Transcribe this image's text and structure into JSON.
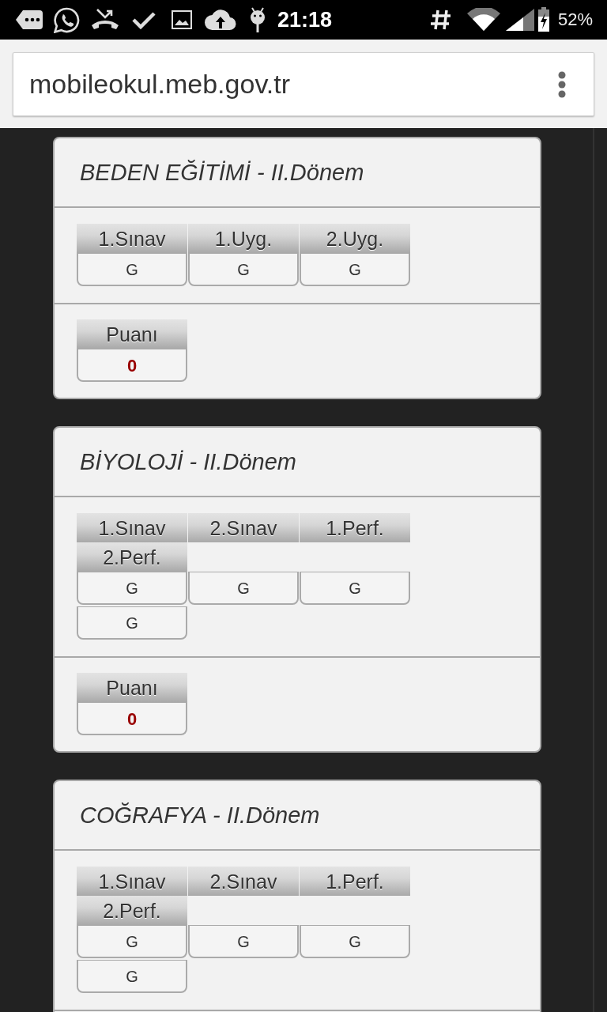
{
  "status_bar": {
    "time": "21:18",
    "battery_percent": "52%"
  },
  "browser": {
    "url": "mobileokul.meb.gov.tr"
  },
  "courses": [
    {
      "title": "BEDEN EĞİTİMİ - II.Dönem",
      "grade_table": {
        "headers": [
          "1.Sınav",
          "1.Uyg.",
          "2.Uyg."
        ],
        "values": [
          "G",
          "G",
          "G"
        ]
      },
      "score": {
        "label": "Puanı",
        "value": "0"
      }
    },
    {
      "title": "BİYOLOJİ - II.Dönem",
      "grade_table": {
        "headers": [
          "1.Sınav",
          "2.Sınav",
          "1.Perf.",
          "2.Perf."
        ],
        "values": [
          "G",
          "G",
          "G",
          "G"
        ]
      },
      "score": {
        "label": "Puanı",
        "value": "0"
      }
    },
    {
      "title": "COĞRAFYA - II.Dönem",
      "grade_table": {
        "headers": [
          "1.Sınav",
          "2.Sınav",
          "1.Perf.",
          "2.Perf."
        ],
        "values": [
          "G",
          "G",
          "G",
          "G"
        ]
      }
    }
  ]
}
